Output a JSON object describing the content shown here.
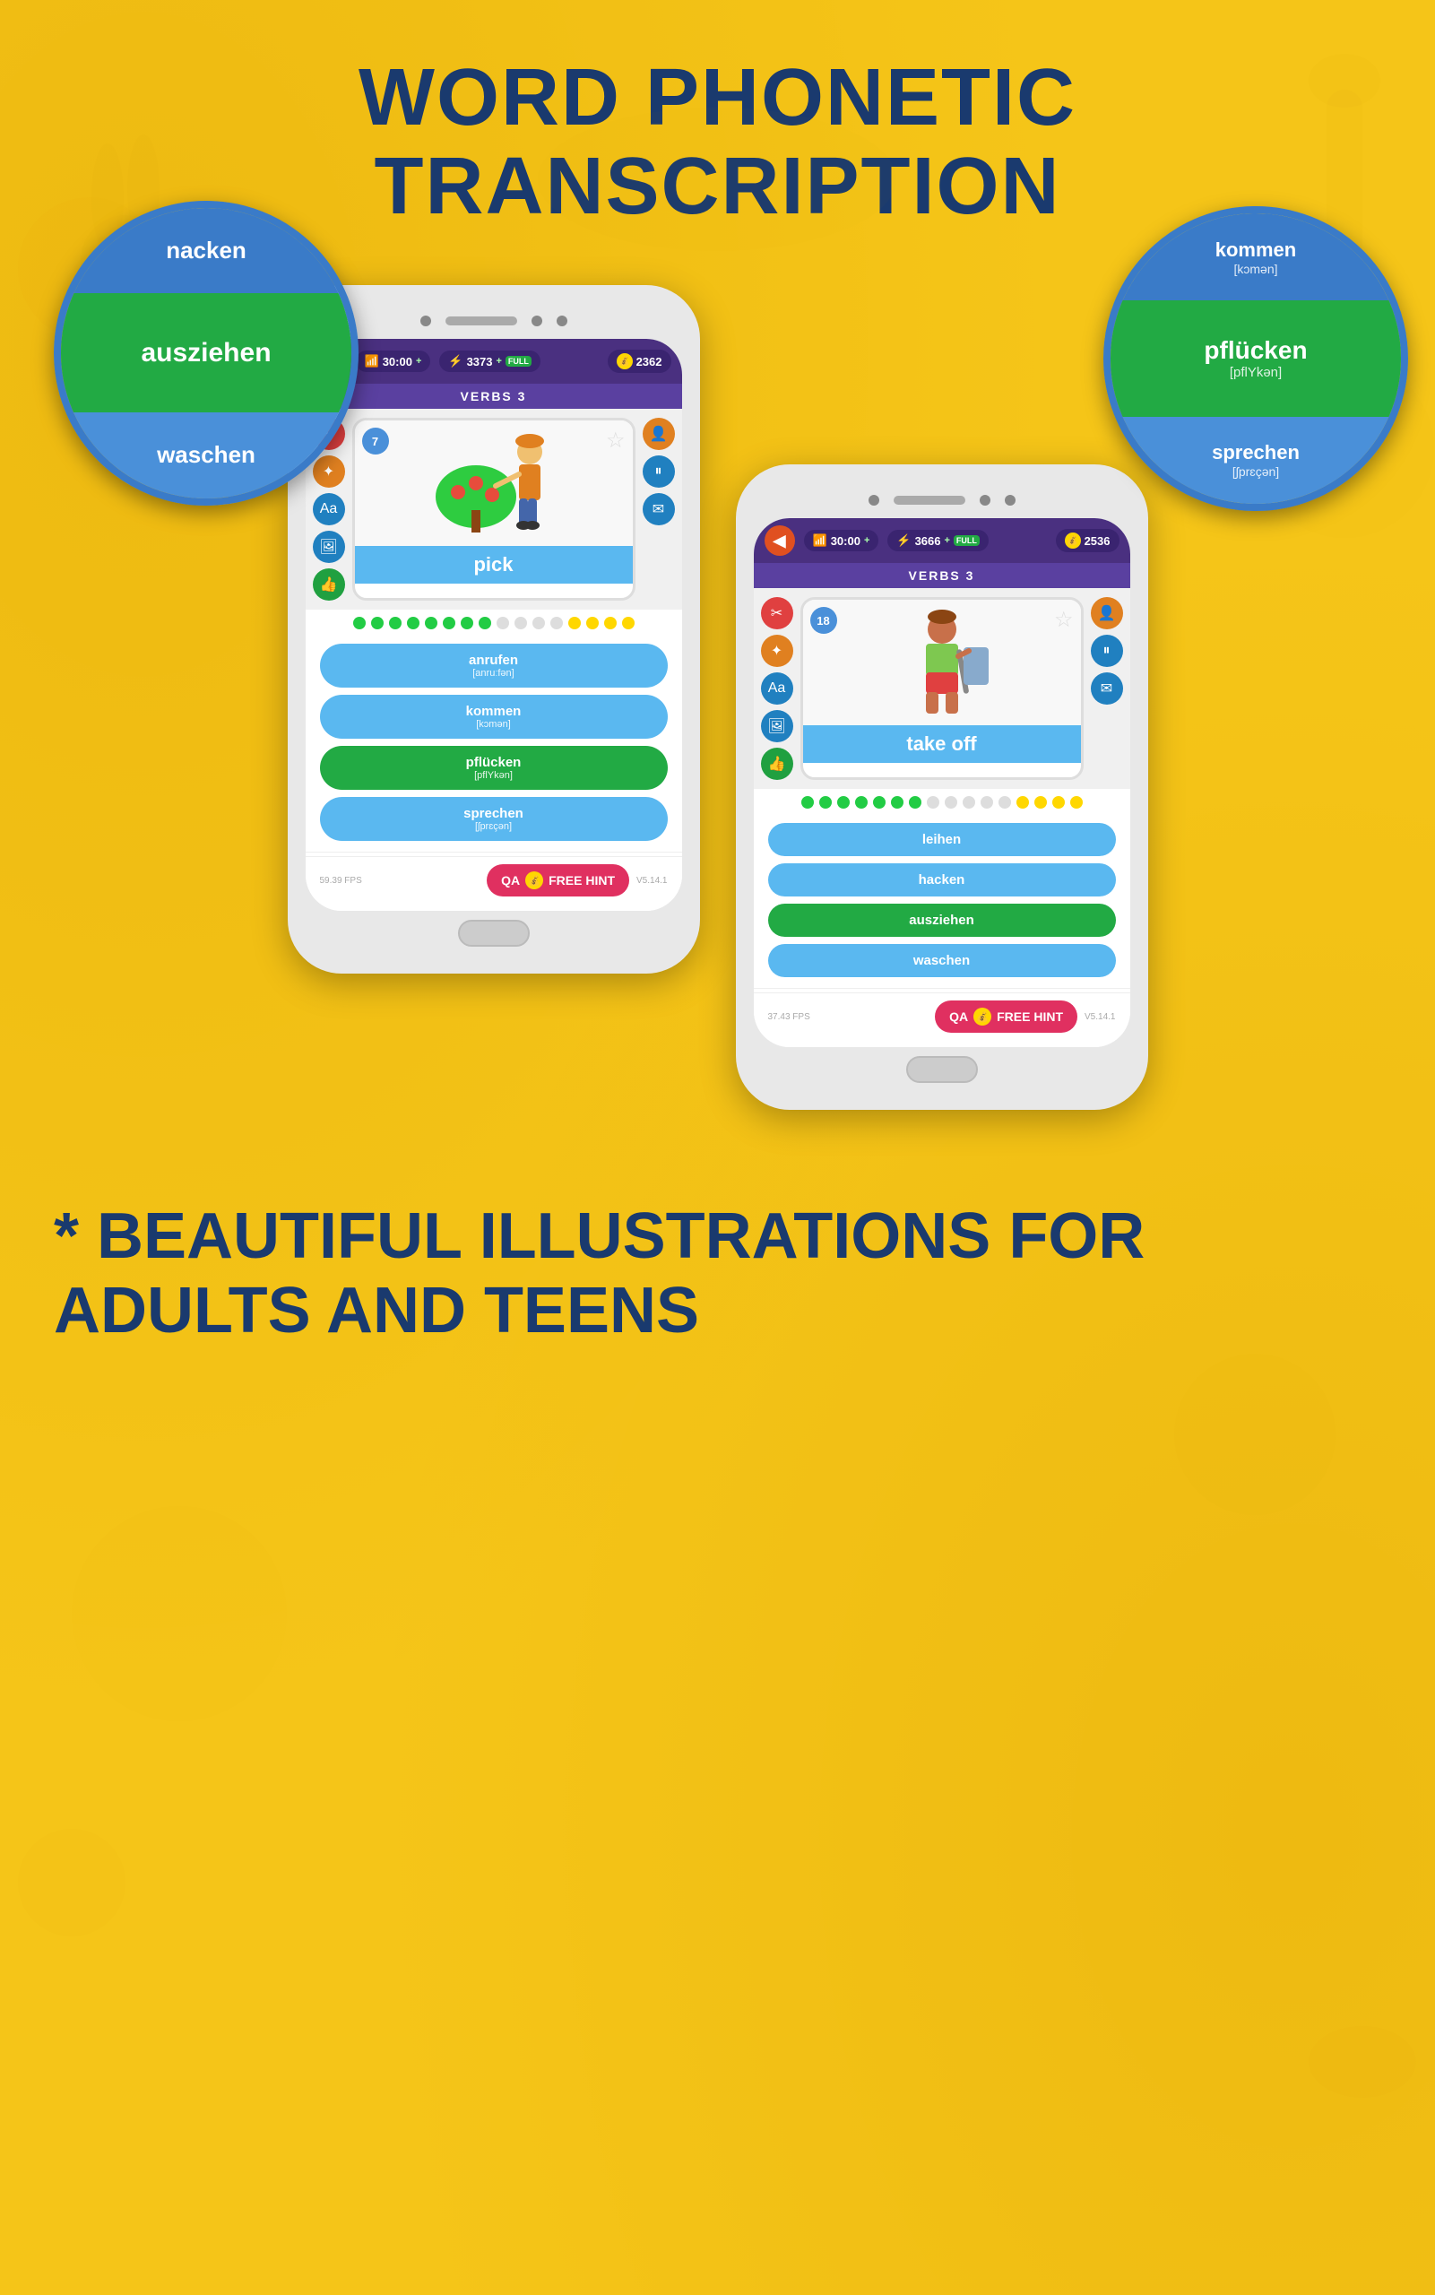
{
  "page": {
    "title": "WORD PHONETIC\nTRANSCRIPTION",
    "footer": {
      "prefix": "* ",
      "text": "BEAUTIFUL ILLUSTRATIONS FOR\nADULTS AND TEENS"
    }
  },
  "phone1": {
    "stats": {
      "time": "30:00",
      "time_plus": "+",
      "score": "3373",
      "score_plus": "+",
      "score_label": "FULL",
      "coins": "2362"
    },
    "category": "VERBS 3",
    "card": {
      "number": "7",
      "word": "pick",
      "image_emoji": "🌿"
    },
    "progress": {
      "green_count": 8,
      "gray_count": 4,
      "yellow_count": 4
    },
    "answers": [
      {
        "word": "anrufen",
        "phonetic": "[anruːfən]",
        "type": "blue"
      },
      {
        "word": "kommen",
        "phonetic": "[kɔmən]",
        "type": "blue"
      },
      {
        "word": "pflücken",
        "phonetic": "[pflYkən]",
        "type": "green"
      },
      {
        "word": "sprechen",
        "phonetic": "[ʃprɛçən]",
        "type": "blue"
      }
    ],
    "hint": {
      "label": "FREE HINT"
    },
    "fps": "59.39 FPS",
    "version": "V5.14.1"
  },
  "phone2": {
    "stats": {
      "time": "30:00",
      "time_plus": "+",
      "score": "3666",
      "score_plus": "+",
      "score_label": "FULL",
      "coins": "2536"
    },
    "category": "VERBS 3",
    "card": {
      "number": "18",
      "word": "take off",
      "image_emoji": "👕"
    },
    "progress": {
      "green_count": 7,
      "gray_count": 5,
      "yellow_count": 4
    },
    "answers": [
      {
        "word": "leihen",
        "phonetic": "",
        "type": "blue"
      },
      {
        "word": "hacken",
        "phonetic": "",
        "type": "blue"
      },
      {
        "word": "ausziehen",
        "phonetic": "",
        "type": "green"
      },
      {
        "word": "waschen",
        "phonetic": "",
        "type": "blue"
      }
    ],
    "hint": {
      "label": "FREE HINT"
    },
    "fps": "37.43 FPS",
    "version": "V5.14.1"
  },
  "right_popup": {
    "items": [
      {
        "word": "kommen",
        "phonetic": "[kɔmən]",
        "type": "blue"
      },
      {
        "word": "pflücken",
        "phonetic": "[pflYkən]",
        "type": "green"
      },
      {
        "word": "sprechen",
        "phonetic": "[ʃprɛçən]",
        "type": "blue"
      }
    ]
  },
  "bottom_circle": {
    "items": [
      {
        "word": "nacken",
        "type": "blue"
      },
      {
        "word": "ausziehen",
        "type": "green"
      },
      {
        "word": "waschen",
        "type": "blue"
      }
    ]
  }
}
